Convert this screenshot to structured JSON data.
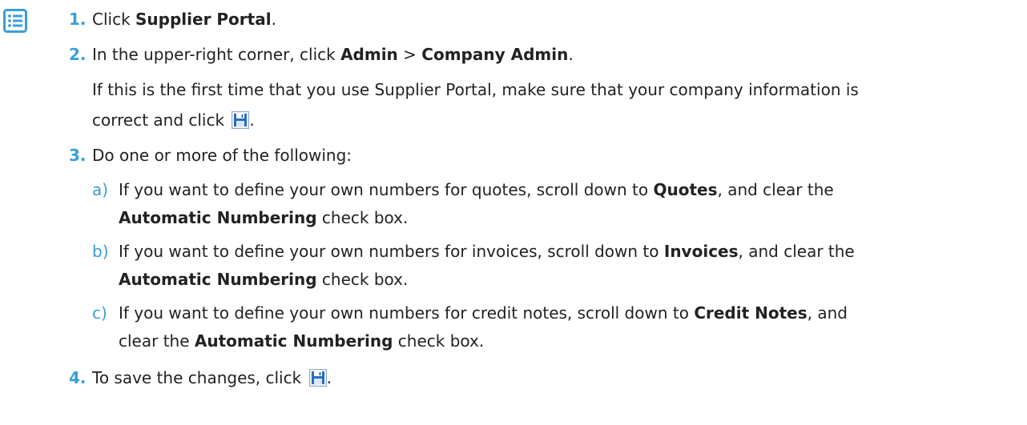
{
  "icons": {
    "steps": "list-icon",
    "save": "floppy-disk-save-icon"
  },
  "colors": {
    "accent": "#3a9fd6",
    "text": "#222222",
    "save_icon_blue": "#2b6cc4"
  },
  "steps": {
    "s1": {
      "num": "1.",
      "pre": "Click ",
      "bold1": "Supplier Portal",
      "post": "."
    },
    "s2": {
      "num": "2.",
      "pre": "In the upper-right corner, click ",
      "bold1": "Admin",
      "mid": " > ",
      "bold2": "Company Admin",
      "post": ".",
      "note_line1": "If this is the first time that you use Supplier Portal, make sure that your company information is",
      "note_line2": "correct and click ",
      "note_end": "."
    },
    "s3": {
      "num": "3.",
      "text": "Do one or more of the following:",
      "a": {
        "label": "a)",
        "pre": "If you want to define your own numbers for quotes, scroll down to ",
        "bold1": "Quotes",
        "post": ", and clear the",
        "bold2": "Automatic Numbering",
        "post2": " check box."
      },
      "b": {
        "label": "b)",
        "pre": "If you want to define your own numbers for invoices, scroll down to ",
        "bold1": "Invoices",
        "post": ", and clear the",
        "bold2": "Automatic Numbering",
        "post2": " check box."
      },
      "c": {
        "label": "c)",
        "pre": "If you want to define your own numbers for credit notes, scroll down to ",
        "bold1": "Credit Notes",
        "post": ", and",
        "line2_pre": "clear the ",
        "bold2": "Automatic Numbering",
        "post2": " check box."
      }
    },
    "s4": {
      "num": "4.",
      "text": "To save the changes, click ",
      "end": "."
    }
  }
}
